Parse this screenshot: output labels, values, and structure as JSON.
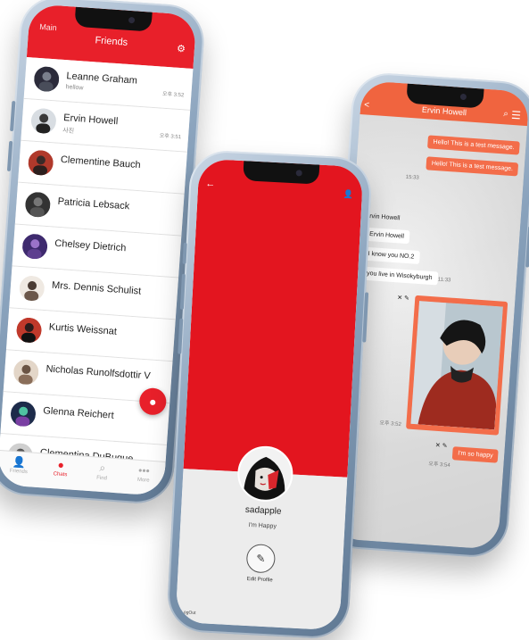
{
  "colors": {
    "primary_red": "#e8202a",
    "chat_orange": "#f36d4a",
    "frame": "#8aa3bd"
  },
  "phone1": {
    "header": {
      "back_label": "Main",
      "title": "Friends"
    },
    "chats": [
      {
        "name": "Leanne Graham",
        "preview": "hellow",
        "time": "오후 3:52"
      },
      {
        "name": "Ervin Howell",
        "preview": "사진",
        "time": "오후 3:51"
      },
      {
        "name": "Clementine Bauch",
        "preview": "",
        "time": ""
      },
      {
        "name": "Patricia Lebsack",
        "preview": "",
        "time": ""
      },
      {
        "name": "Chelsey Dietrich",
        "preview": "",
        "time": ""
      },
      {
        "name": "Mrs. Dennis Schulist",
        "preview": "",
        "time": ""
      },
      {
        "name": "Kurtis Weissnat",
        "preview": "",
        "time": ""
      },
      {
        "name": "Nicholas Runolfsdottir V",
        "preview": "",
        "time": ""
      },
      {
        "name": "Glenna Reichert",
        "preview": "",
        "time": ""
      },
      {
        "name": "Clementina DuBuque",
        "preview": "",
        "time": ""
      }
    ],
    "nav": [
      {
        "label": "Friends",
        "icon": "person-icon"
      },
      {
        "label": "Chats",
        "icon": "chat-bubble-icon"
      },
      {
        "label": "Find",
        "icon": "search-icon"
      },
      {
        "label": "More",
        "icon": "more-icon"
      }
    ]
  },
  "phone2": {
    "name": "sadapple",
    "status": "I'm Happy",
    "edit_label": "Edit Profile",
    "logout_label": "LogOut"
  },
  "phone3": {
    "title": "Ervin Howell",
    "messages": {
      "m1": "Hello! This is a test message.",
      "m2": "Hello! This is a test message.",
      "t1": "15:33",
      "sender": "Ervin Howell",
      "m3": "Ervin Howell",
      "m4": "I know you NO.2",
      "m5": "you live in Wisokyburgh",
      "t2": "11:33",
      "photo_time": "오후 3:52",
      "m6": "I'm so happy",
      "t3": "오후 3:54"
    }
  }
}
